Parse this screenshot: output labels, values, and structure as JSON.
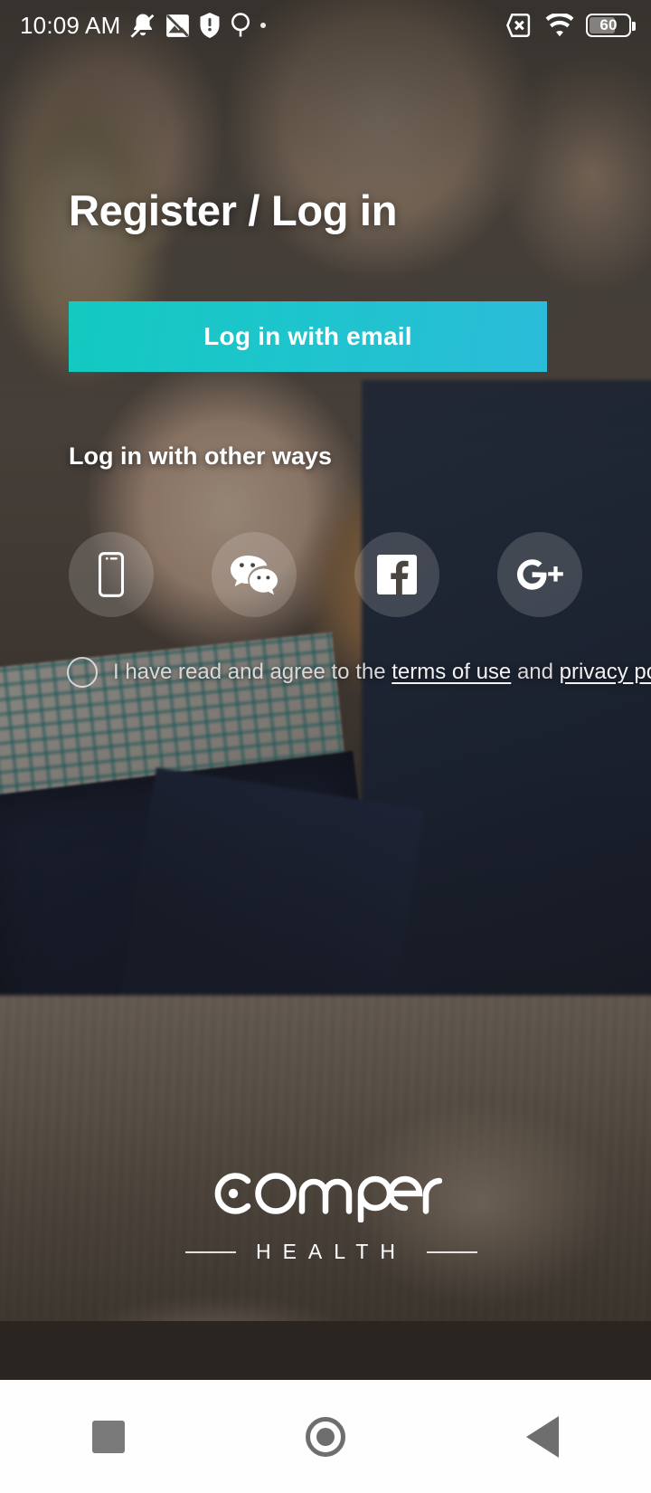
{
  "status_bar": {
    "time": "10:09 AM",
    "icons": [
      {
        "name": "mute-bell-icon"
      },
      {
        "name": "image-broken-icon"
      },
      {
        "name": "shield-warning-icon"
      },
      {
        "name": "location-pin-icon"
      },
      {
        "name": "small-dot-icon"
      }
    ],
    "right_icons": [
      {
        "name": "sim-missing-icon"
      },
      {
        "name": "wifi-icon"
      }
    ],
    "battery_level": "60"
  },
  "screen": {
    "title": "Register / Log in",
    "primary_button": "Log in with email",
    "other_ways_label": "Log in with other ways",
    "social_buttons": [
      {
        "name": "phone-icon",
        "label": "Phone"
      },
      {
        "name": "wechat-icon",
        "label": "WeChat"
      },
      {
        "name": "facebook-icon",
        "label": "Facebook"
      },
      {
        "name": "google-plus-icon",
        "label": "Google+"
      }
    ],
    "terms": {
      "checked": false,
      "prefix": "I have read and agree to the ",
      "terms_link": "terms of use",
      "conjunction": " and ",
      "privacy_link": "privacy policy"
    }
  },
  "branding": {
    "name": "comper",
    "tagline": "HEALTH"
  },
  "nav_bar": {
    "recents_label": "Recents",
    "home_label": "Home",
    "back_label": "Back"
  },
  "colors": {
    "button_gradient_start": "#13c9c0",
    "button_gradient_end": "#2bbcd9",
    "text_primary": "#ffffff",
    "text_secondary": "#d8d8d8"
  }
}
